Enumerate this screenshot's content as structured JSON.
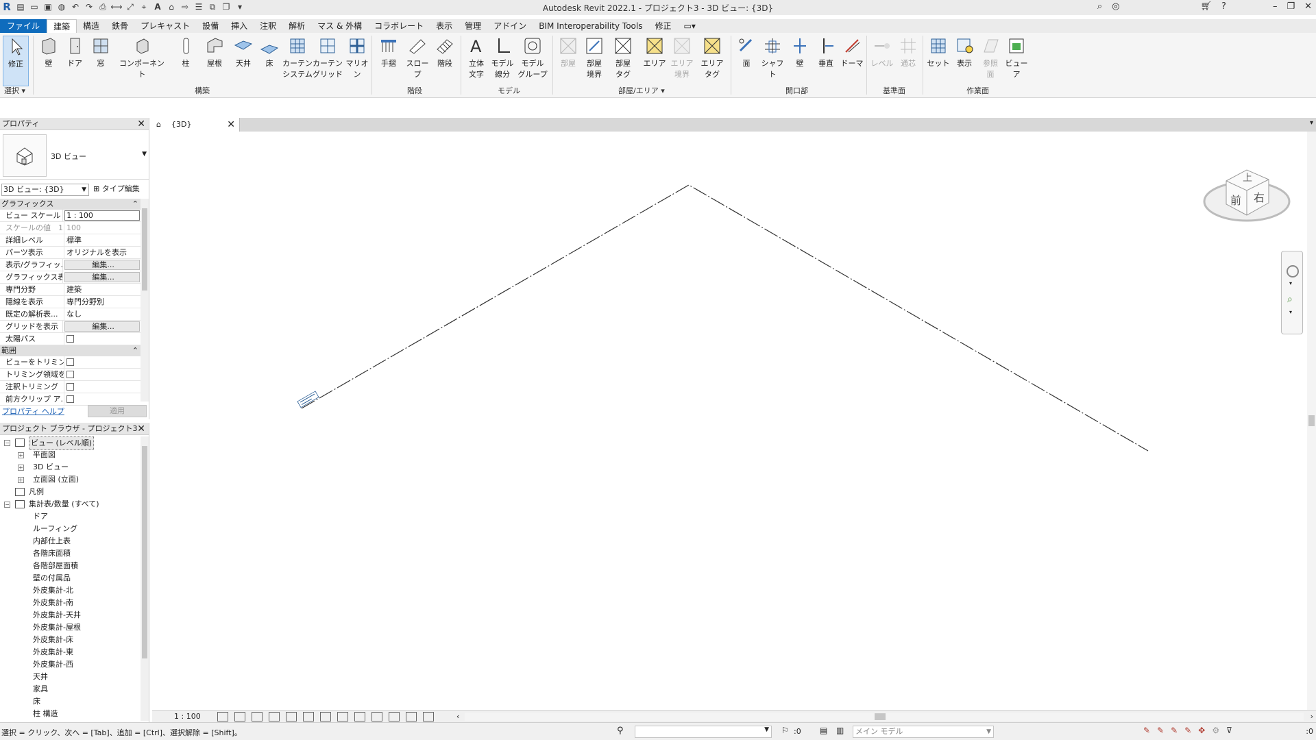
{
  "app": {
    "title": "Autodesk Revit 2022.1 - プロジェクト3 - 3D ビュー: {3D}"
  },
  "menu_tabs": [
    "ファイル",
    "建築",
    "構造",
    "鉄骨",
    "プレキャスト",
    "設備",
    "挿入",
    "注釈",
    "解析",
    "マス & 外構",
    "コラボレート",
    "表示",
    "管理",
    "アドイン",
    "BIM Interoperability Tools",
    "修正"
  ],
  "ribbon": {
    "buttons": {
      "modify": "修正",
      "wall": "壁",
      "door": "ドア",
      "window": "窓",
      "component": "コンポーネント",
      "column": "柱",
      "roof": "屋根",
      "ceiling": "天井",
      "floor": "床",
      "curtain_system": "カーテン\nシステム",
      "curtain_grid": "カーテン\nグリッド",
      "mullion": "マリオン",
      "railing": "手摺",
      "ramp": "スロープ",
      "stair": "階段",
      "model_text": "立体\n文字",
      "model_line": "モデル\n線分",
      "model_group": "モデル\nグループ",
      "room": "部屋",
      "room_sep": "部屋\n境界",
      "room_tag": "部屋\nタグ",
      "area": "エリア",
      "area_boundary": "エリア\n境界",
      "area_tag": "エリア\nタグ",
      "by_face": "面",
      "shaft": "シャフト",
      "wall_opening": "壁",
      "vertical": "垂直",
      "dormer": "ドーマ",
      "level": "レベル",
      "grid": "通芯",
      "set": "セット",
      "show": "表示",
      "ref_plane": "参照\n面",
      "viewer": "ビューア"
    },
    "panels": {
      "select": "選択",
      "build": "構築",
      "circulation": "階段",
      "model": "モデル",
      "room_area": "部屋/エリア",
      "opening": "開口部",
      "datum": "基準面",
      "work_plane": "作業面"
    }
  },
  "properties": {
    "title": "プロパティ",
    "type_name": "3D ビュー",
    "instance_selector": "3D ビュー: {3D}",
    "edit_type": "タイプ編集",
    "categories": {
      "graphics": "グラフィックス",
      "extents": "範囲"
    },
    "rows": [
      {
        "k": "ビュー スケール",
        "v": "1 : 100",
        "kind": "inp"
      },
      {
        "k": "スケールの値　1:",
        "v": "100",
        "kind": "gray"
      },
      {
        "k": "詳細レベル",
        "v": "標準",
        "kind": "txt"
      },
      {
        "k": "パーツ表示",
        "v": "オリジナルを表示",
        "kind": "txt"
      },
      {
        "k": "表示/グラフィッ...",
        "v": "編集...",
        "kind": "btn"
      },
      {
        "k": "グラフィックス表...",
        "v": "編集...",
        "kind": "btn"
      },
      {
        "k": "専門分野",
        "v": "建築",
        "kind": "txt"
      },
      {
        "k": "隠線を表示",
        "v": "専門分野別",
        "kind": "txt"
      },
      {
        "k": "既定の解析表...",
        "v": "なし",
        "kind": "txt"
      },
      {
        "k": "グリッドを表示",
        "v": "編集...",
        "kind": "btn"
      },
      {
        "k": "太陽パス",
        "v": "",
        "kind": "cb"
      }
    ],
    "rows2": [
      {
        "k": "ビューをトリミング",
        "v": "",
        "kind": "cb"
      },
      {
        "k": "トリミング領域を...",
        "v": "",
        "kind": "cb"
      },
      {
        "k": "注釈トリミング",
        "v": "",
        "kind": "cb"
      },
      {
        "k": "前方クリップ ア...",
        "v": "",
        "kind": "cb"
      }
    ],
    "help": "プロパティ ヘルプ",
    "apply": "適用"
  },
  "browser": {
    "title": "プロジェクト ブラウザ - プロジェクト3",
    "items": [
      {
        "label": "ビュー (レベル順)",
        "level": 0,
        "exp": "-",
        "hl": true
      },
      {
        "label": "平面図",
        "level": 1,
        "exp": "+"
      },
      {
        "label": "3D ビュー",
        "level": 1,
        "exp": "+"
      },
      {
        "label": "立面図 (立面)",
        "level": 1,
        "exp": "+"
      },
      {
        "label": "凡例",
        "level": 0,
        "exp": ""
      },
      {
        "label": "集計表/数量 (すべて)",
        "level": 0,
        "exp": "-"
      },
      {
        "label": "ドア",
        "level": 2
      },
      {
        "label": "ルーフィング",
        "level": 2
      },
      {
        "label": "内部仕上表",
        "level": 2
      },
      {
        "label": "各階床面積",
        "level": 2
      },
      {
        "label": "各階部屋面積",
        "level": 2
      },
      {
        "label": "壁の付属品",
        "level": 2
      },
      {
        "label": "外皮集計-北",
        "level": 2
      },
      {
        "label": "外皮集計-南",
        "level": 2
      },
      {
        "label": "外皮集計-天井",
        "level": 2
      },
      {
        "label": "外皮集計-屋根",
        "level": 2
      },
      {
        "label": "外皮集計-床",
        "level": 2
      },
      {
        "label": "外皮集計-東",
        "level": 2
      },
      {
        "label": "外皮集計-西",
        "level": 2
      },
      {
        "label": "天井",
        "level": 2
      },
      {
        "label": "家具",
        "level": 2
      },
      {
        "label": "床",
        "level": 2
      },
      {
        "label": "柱 構造",
        "level": 2
      }
    ]
  },
  "view": {
    "tab_label": "{3D}",
    "scale": "1 : 100",
    "viewcube": {
      "top": "上",
      "front": "前",
      "right": "右"
    }
  },
  "status": {
    "message": "選択 = クリック、次へ = [Tab]、追加 = [Ctrl]、選択解除 = [Shift]。",
    "count1": ":0",
    "model": "メイン モデル",
    "count2": ":0"
  }
}
